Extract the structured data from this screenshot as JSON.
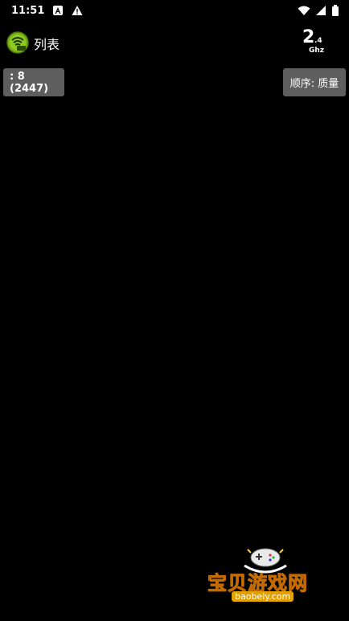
{
  "status_bar": {
    "time": "11:51"
  },
  "app_bar": {
    "title": "列表",
    "band_main": "2",
    "band_sub": ".4",
    "band_unit": "Ghz"
  },
  "toolbar": {
    "count_label": ": 8 (2447)",
    "order_label": "顺序: 质量"
  },
  "watermark": {
    "title": "宝贝游戏网",
    "url": "baobeiy.com"
  },
  "colors": {
    "background": "#000000",
    "button": "#5e5e5e",
    "logo_green": "#7ab317"
  }
}
